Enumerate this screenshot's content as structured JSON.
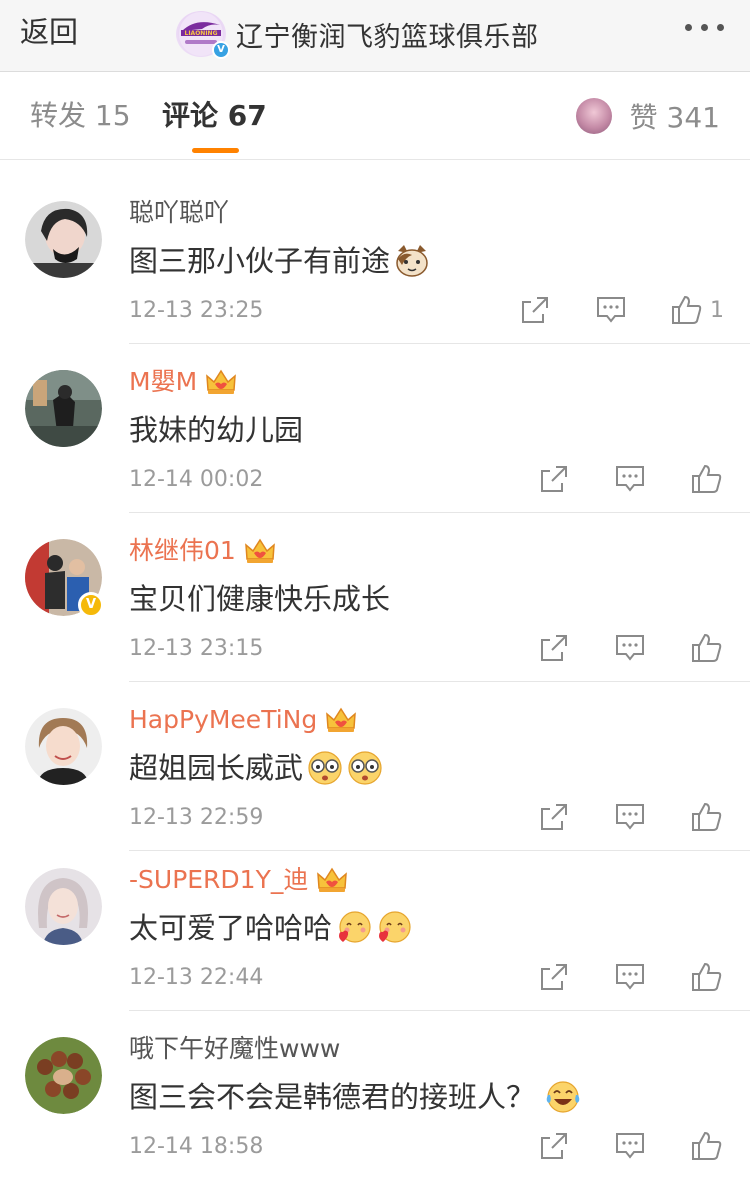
{
  "header": {
    "back_label": "返回",
    "title": "辽宁衡润飞豹篮球俱乐部",
    "logo_text": "LIAONING",
    "icons": {
      "logo": "club-logo-icon",
      "verified": "verified-badge-icon",
      "more": "more-dots-icon"
    }
  },
  "tabs": {
    "repost": "转发 15",
    "comment": "评论 67",
    "likes": "赞 341",
    "active_color": "#ff8200"
  },
  "comments": [
    {
      "username": "聪吖聪吖",
      "vip": false,
      "verified": false,
      "text": "图三那小伙子有前途",
      "emojis": [
        "cat-face-emoji"
      ],
      "time": "12-13 23:25",
      "like_count": "1"
    },
    {
      "username": "M嬰M",
      "vip": true,
      "verified": false,
      "text": "我妹的幼儿园",
      "emojis": [],
      "time": "12-14 00:02",
      "like_count": ""
    },
    {
      "username": "林继伟01",
      "vip": true,
      "verified": true,
      "text": "宝贝们健康快乐成长",
      "emojis": [],
      "time": "12-13 23:15",
      "like_count": ""
    },
    {
      "username": "HapPyMeeTiNg",
      "vip": true,
      "verified": false,
      "text": "超姐园长威武",
      "emojis": [
        "awesome-emoji",
        "awesome-emoji"
      ],
      "time": "12-13 22:59",
      "like_count": ""
    },
    {
      "username": "-SUPERD1Y_迪",
      "vip": true,
      "verified": false,
      "text": "太可爱了哈哈哈",
      "emojis": [
        "love-you-emoji",
        "love-you-emoji"
      ],
      "time": "12-13 22:44",
      "like_count": ""
    },
    {
      "username": "哦下午好魔性www",
      "vip": false,
      "verified": false,
      "text": "图三会不会是韩德君的接班人？",
      "emojis": [
        "laugh-cry-emoji"
      ],
      "time": "12-14 18:58",
      "like_count": ""
    }
  ],
  "colors": {
    "vip_name": "#eb7350",
    "plain_name": "#555555",
    "time": "#9b9b9b",
    "verified_badge": "#f5b90a"
  }
}
